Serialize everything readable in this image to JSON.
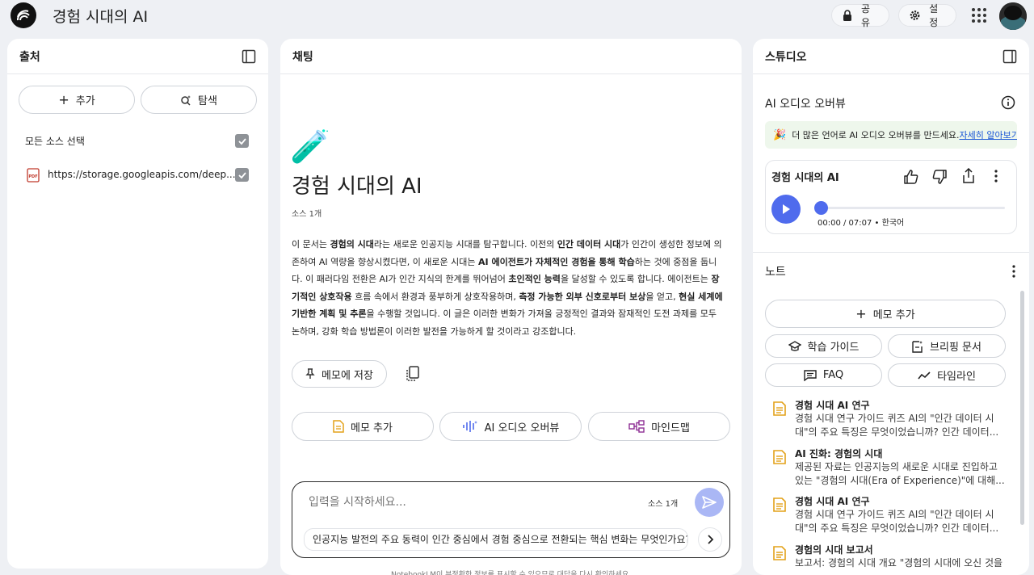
{
  "header": {
    "title": "경험 시대의 AI",
    "share_label": "공유",
    "settings_label": "설정"
  },
  "sources": {
    "title": "출처",
    "add_label": "추가",
    "explore_label": "탐색",
    "select_all_label": "모든 소스 선택",
    "items": [
      {
        "type_badge": "PDF",
        "label": "https://storage.googleapis.com/deep..."
      }
    ]
  },
  "chat": {
    "title": "채팅",
    "emoji": "🧪",
    "doc_title": "경험 시대의 AI",
    "source_count": "소스 1개",
    "summary": [
      {
        "t": "이 문서는 "
      },
      {
        "t": "경험의 시대",
        "b": true
      },
      {
        "t": "라는 새로운 인공지능 시대를 탐구합니다. 이전의 "
      },
      {
        "t": "인간 데이터 시대",
        "b": true
      },
      {
        "t": "가 인간이 생성한 정보에 의존하여 AI 역량을 향상시켰다면, 이 새로운 시대는 "
      },
      {
        "t": "AI 에이전트가 자체적인 경험을 통해 학습",
        "b": true
      },
      {
        "t": "하는 것에 중점을 둡니다. 이 패러다임 전환은 AI가 인간 지식의 한계를 뛰어넘어 "
      },
      {
        "t": "초인적인 능력",
        "b": true
      },
      {
        "t": "을 달성할 수 있도록 합니다. 에이전트는 "
      },
      {
        "t": "장기적인 상호작용",
        "b": true
      },
      {
        "t": " 흐름 속에서 환경과 풍부하게 상호작용하며, "
      },
      {
        "t": "측정 가능한 외부 신호로부터 보상",
        "b": true
      },
      {
        "t": "을 얻고, "
      },
      {
        "t": "현실 세계에 기반한 계획 및 추론",
        "b": true
      },
      {
        "t": "을 수행할 것입니다. 이 글은 이러한 변화가 가져올 긍정적인 결과와 잠재적인 도전 과제를 모두 논하며, 강화 학습 방법론이 이러한 발전을 가능하게 할 것이라고 강조합니다."
      }
    ],
    "save_note_label": "메모에 저장",
    "add_note_label": "메모 추가",
    "audio_overview_label": "AI 오디오 오버뷰",
    "mindmap_label": "마인드맵",
    "input_placeholder": "입력을 시작하세요...",
    "input_source_count": "소스 1개",
    "suggestion": "인공지능 발전의 주요 동력이 인간 중심에서 경험 중심으로 전환되는 핵심 변화는 무엇인가요?",
    "footer_text": "NotebookLM이 부정확한 정보를 표시할 수 있으므로 대답을 다시 확인하세요."
  },
  "studio": {
    "title": "스튜디오",
    "audio_section_title": "AI 오디오 오버뷰",
    "banner_text": "더 많은 언어로 AI 오디오 오버뷰를 만드세요.",
    "banner_link": "자세히 알아보기",
    "player_title": "경험 시대의 AI",
    "player_time": "00:00 / 07:07",
    "player_lang": "한국어",
    "player_progress": 0,
    "notes_title": "노트",
    "add_memo_label": "메모 추가",
    "study_guide_label": "학습 가이드",
    "briefing_label": "브리핑 문서",
    "faq_label": "FAQ",
    "timeline_label": "타임라인",
    "notes": [
      {
        "title": "경험 시대 AI 연구",
        "line1": "경험 시대 연구 가이드 퀴즈 AI의 \"인간 데이터 시",
        "line2": "대\"의 주요 특징은 무엇이었습니까? 인간 데이터..."
      },
      {
        "title": "AI 진화: 경험의 시대",
        "line1": "제공된 자료는 인공지능의 새로운 시대로 진입하고",
        "line2": "있는 \"경험의 시대(Era of Experience)\"에 대해..."
      },
      {
        "title": "경험 시대 AI 연구",
        "line1": "경험 시대 연구 가이드 퀴즈 AI의 \"인간 데이터 시",
        "line2": "대\"의 주요 특징은 무엇이었습니까? 인간 데이터..."
      },
      {
        "title": "경험의 시대 보고서",
        "line1": "보고서: 경험의 시대 개요 \"경험의 시대에 오신 것을",
        "line2": ""
      }
    ]
  },
  "colors": {
    "accent": "#4f6bed",
    "send_button": "#aab7f5",
    "banner_bg": "#eef7ec",
    "note_icon": "#e3a21a",
    "mindmap_icon": "#8e2f95",
    "pdf_icon": "#c0392b"
  }
}
